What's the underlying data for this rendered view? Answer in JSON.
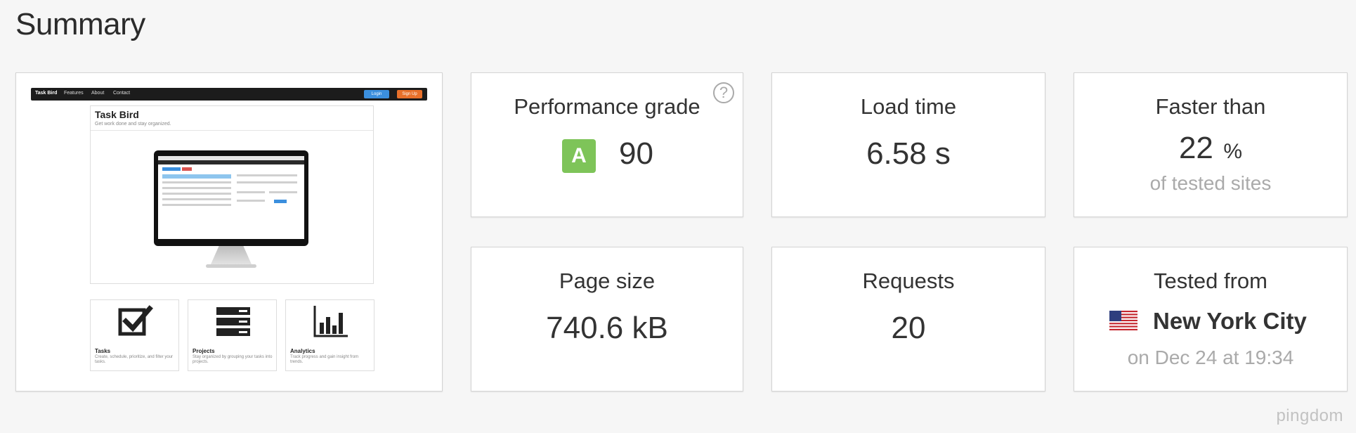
{
  "page": {
    "title": "Summary"
  },
  "screenshot": {
    "nav": {
      "brand": "Task Bird",
      "links": [
        "Features",
        "About",
        "Contact"
      ],
      "login": "Login",
      "signup": "Sign Up",
      "login_color": "#3b8fde",
      "signup_color": "#e8702a"
    },
    "hero": {
      "title": "Task Bird",
      "subtitle": "Get work done and stay organized."
    },
    "features": [
      {
        "icon": "checkbox-icon",
        "title": "Tasks",
        "desc": "Create, schedule, prioritize, and filter your tasks."
      },
      {
        "icon": "stack-icon",
        "title": "Projects",
        "desc": "Stay organized by grouping your tasks into projects."
      },
      {
        "icon": "bar-chart-icon",
        "title": "Analytics",
        "desc": "Track progress and gain insight from trends."
      }
    ]
  },
  "metrics": {
    "performance": {
      "label": "Performance grade",
      "grade": "A",
      "score": "90",
      "grade_color": "#7ec459",
      "help": "?"
    },
    "load_time": {
      "label": "Load time",
      "value": "6.58 s"
    },
    "faster_than": {
      "label": "Faster than",
      "value": "22",
      "unit": "%",
      "sub": "of tested sites"
    },
    "page_size": {
      "label": "Page size",
      "value": "740.6 kB"
    },
    "requests": {
      "label": "Requests",
      "value": "20"
    },
    "tested_from": {
      "label": "Tested from",
      "location": "New York City",
      "flag": "us-flag-icon",
      "sub": "on Dec 24 at 19:34"
    }
  },
  "watermark": "pingdom"
}
